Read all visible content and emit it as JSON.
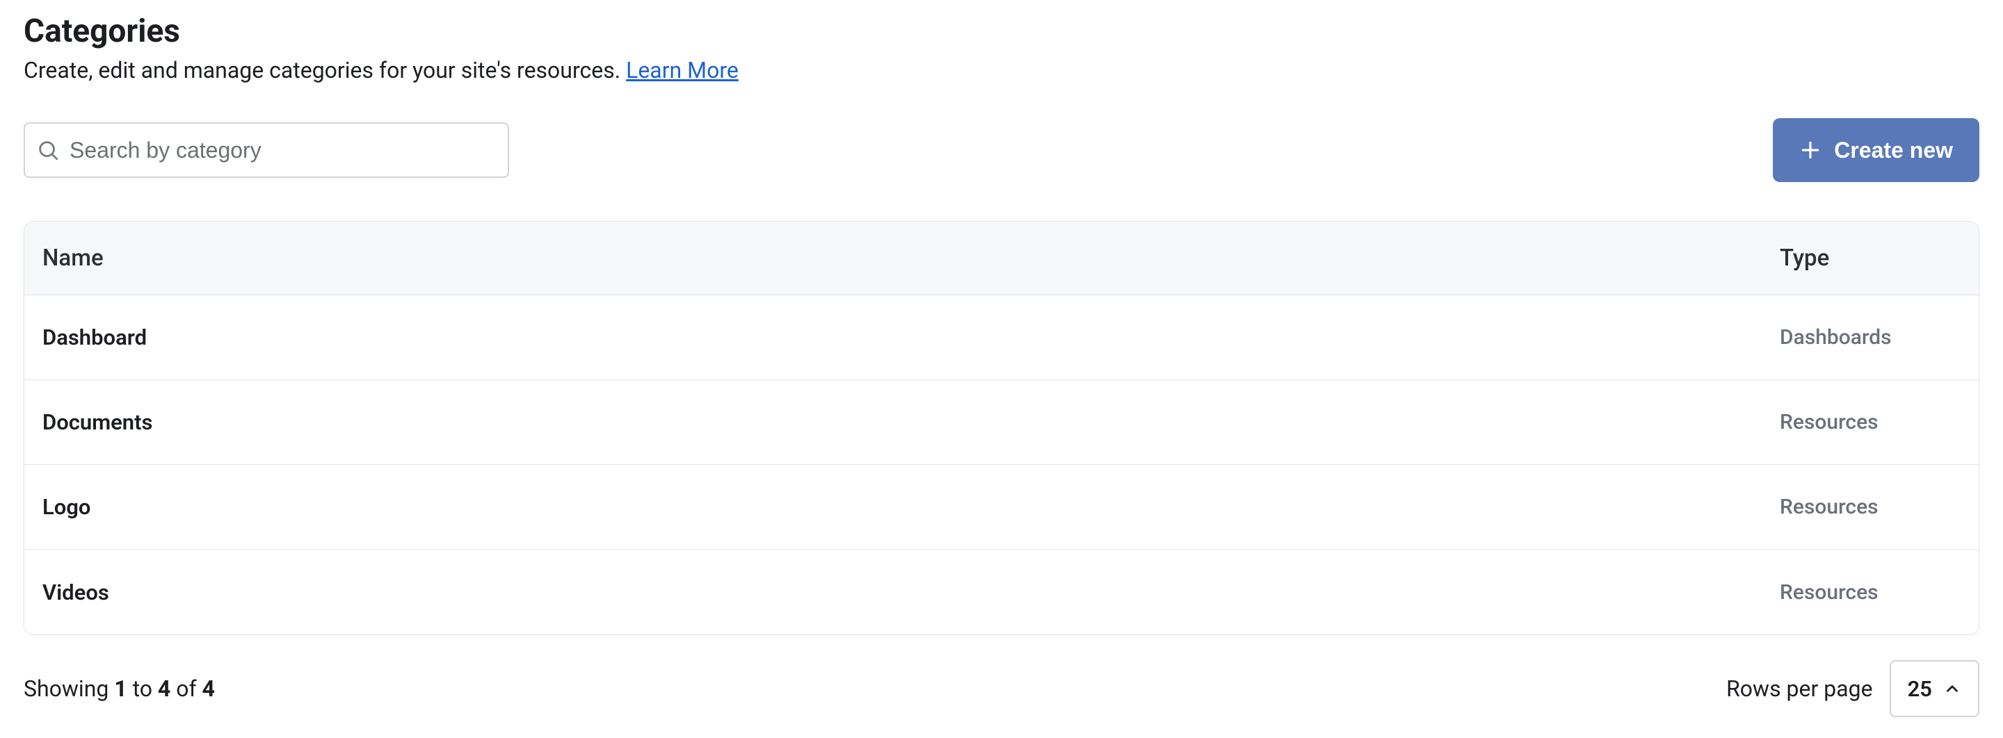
{
  "header": {
    "title": "Categories",
    "subtitle_prefix": "Create, edit and manage categories for your site's resources. ",
    "learn_more": "Learn More"
  },
  "search": {
    "placeholder": "Search by category"
  },
  "create_button": {
    "label": "Create new"
  },
  "table": {
    "columns": {
      "name": "Name",
      "type": "Type"
    },
    "rows": [
      {
        "name": "Dashboard",
        "type": "Dashboards"
      },
      {
        "name": "Documents",
        "type": "Resources"
      },
      {
        "name": "Logo",
        "type": "Resources"
      },
      {
        "name": "Videos",
        "type": "Resources"
      }
    ]
  },
  "pagination": {
    "word_showing": "Showing",
    "word_to": "to",
    "word_of": "of",
    "from": "1",
    "to": "4",
    "total": "4",
    "rows_per_page_label": "Rows per page",
    "rows_per_page_value": "25"
  }
}
